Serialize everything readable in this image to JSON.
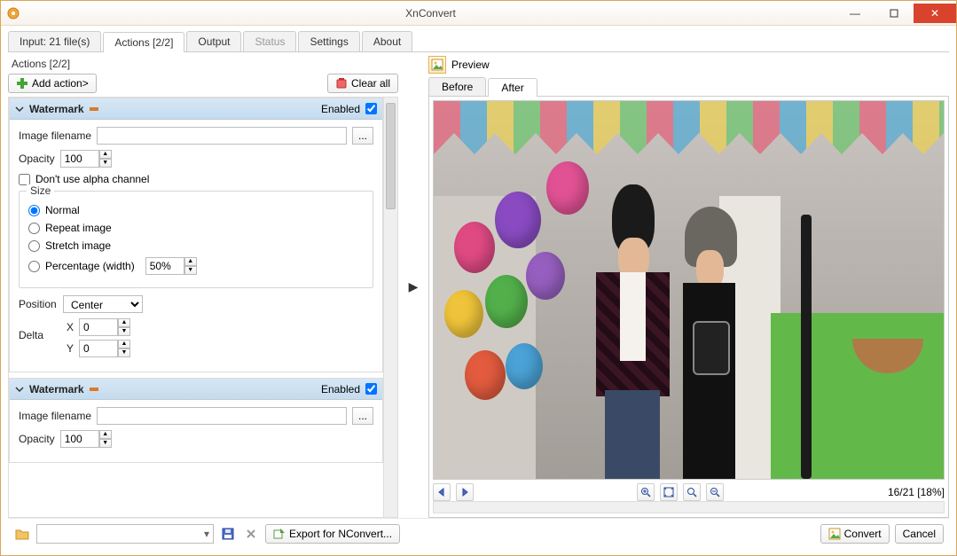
{
  "window": {
    "title": "XnConvert"
  },
  "tabs": {
    "input": "Input: 21 file(s)",
    "actions": "Actions [2/2]",
    "output": "Output",
    "status": "Status",
    "settings": "Settings",
    "about": "About",
    "active": "actions"
  },
  "actions_panel": {
    "title": "Actions [2/2]",
    "add_action": "Add action>",
    "clear_all": "Clear all",
    "cards": [
      {
        "name": "Watermark",
        "enabled_label": "Enabled",
        "enabled": true,
        "image_filename_label": "Image filename",
        "image_filename": "",
        "browse": "...",
        "opacity_label": "Opacity",
        "opacity": "100",
        "alpha_label": "Don't use alpha channel",
        "alpha_checked": false,
        "size": {
          "legend": "Size",
          "normal": "Normal",
          "repeat": "Repeat image",
          "stretch": "Stretch image",
          "percentage": "Percentage (width)",
          "percentage_value": "50%",
          "selected": "normal"
        },
        "position_label": "Position",
        "position_value": "Center",
        "delta_label": "Delta",
        "delta_x_label": "X",
        "delta_y_label": "Y",
        "delta_x": "0",
        "delta_y": "0"
      },
      {
        "name": "Watermark",
        "enabled_label": "Enabled",
        "enabled": true,
        "image_filename_label": "Image filename",
        "image_filename": "",
        "browse": "...",
        "opacity_label": "Opacity",
        "opacity": "100"
      }
    ]
  },
  "preview": {
    "label": "Preview",
    "before": "Before",
    "after": "After",
    "active": "after",
    "counter": "16/21 [18%]"
  },
  "footer": {
    "export": "Export for NConvert...",
    "convert": "Convert",
    "cancel": "Cancel"
  },
  "icons": {
    "add": "add-icon",
    "clear": "clear-icon",
    "save": "save-icon",
    "delete": "delete-icon",
    "export": "export-icon",
    "convert": "convert-icon",
    "folder": "folder-icon",
    "prev": "arrow-left-icon",
    "next": "arrow-right-icon",
    "zoom_in": "zoom-in-icon",
    "fit": "zoom-fit-icon",
    "zoom_100": "zoom-100-icon",
    "zoom_out": "zoom-out-icon",
    "expand": "arrow-right-small-icon",
    "preview": "image-icon"
  },
  "colors": {
    "accent_close": "#d9432d",
    "section_header": "#c9dff0",
    "border": "#d9a55c"
  }
}
